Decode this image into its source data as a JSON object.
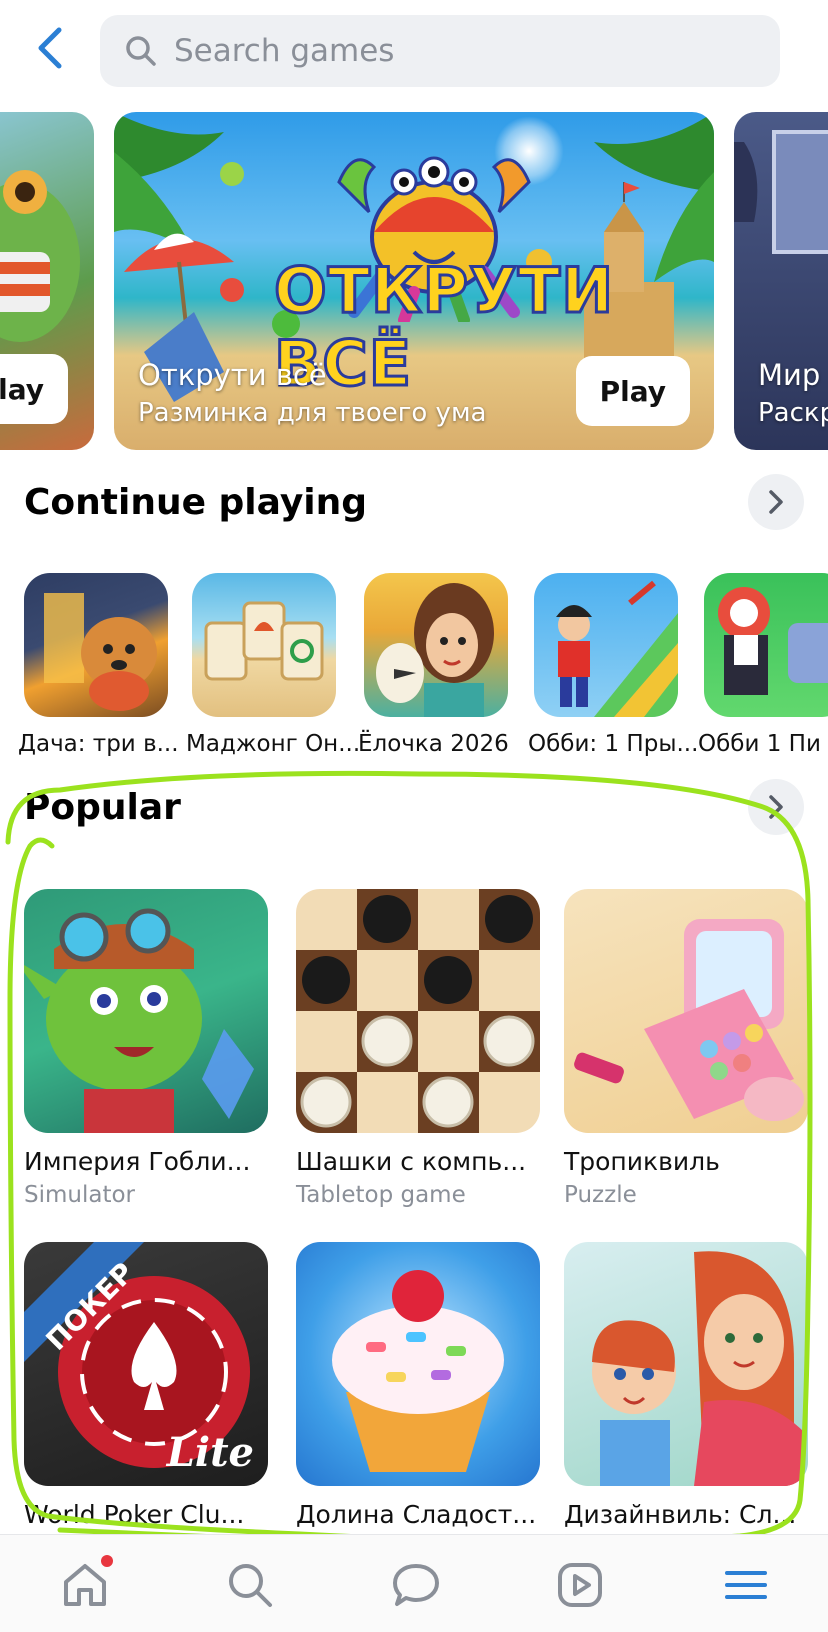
{
  "header": {
    "search_placeholder": "Search games",
    "back_icon": "chevron-left-icon",
    "search_icon": "search-icon"
  },
  "banners": [
    {
      "title": "",
      "subtitle": "",
      "play_label": "Play"
    },
    {
      "title": "Открути всё",
      "subtitle": "Разминка для твоего ума",
      "play_label": "Play",
      "logo": "ОТКРУТИ ВСЁ"
    },
    {
      "title": "Мир",
      "subtitle": "Раскр",
      "play_label": ""
    }
  ],
  "continue_playing": {
    "title": "Continue playing",
    "items": [
      {
        "label": "Дача: три в..."
      },
      {
        "label": "Маджонг Он..."
      },
      {
        "label": "Ёлочка 2026"
      },
      {
        "label": "Обби: 1 Пры..."
      },
      {
        "label": "Обби 1 Пи"
      }
    ]
  },
  "popular": {
    "title": "Popular",
    "items": [
      {
        "name": "Империя Гобли...",
        "category": "Simulator"
      },
      {
        "name": "Шашки с компь...",
        "category": "Tabletop game"
      },
      {
        "name": "Тропиквиль",
        "category": "Puzzle"
      },
      {
        "name": "World Poker Clu...",
        "category": ""
      },
      {
        "name": "Долина Сладост...",
        "category": ""
      },
      {
        "name": "Дизайнвиль: Сл...",
        "category": ""
      }
    ],
    "poker_badge": "ПОКЕР",
    "poker_lite": "Lite"
  },
  "navbar": {
    "items": [
      "home-icon",
      "search-icon",
      "chat-icon",
      "video-icon",
      "menu-icon"
    ],
    "active": "menu-icon",
    "accent": "#2b7fd4",
    "notification_dot": "#e8363f"
  },
  "colors": {
    "accent": "#2b7fd4",
    "annotation": "#9be21e"
  }
}
